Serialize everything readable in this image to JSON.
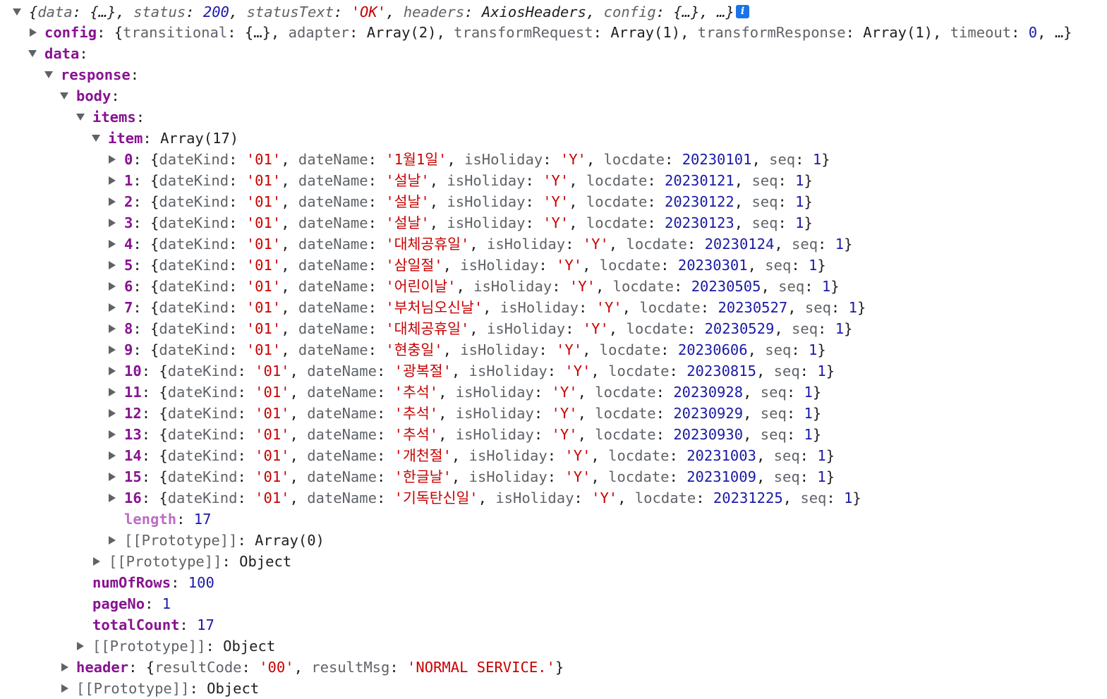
{
  "root": {
    "summary_open": "{",
    "k_data": "data",
    "v_data": "{…}",
    "k_status": "status",
    "v_status": "200",
    "k_statusText": "statusText",
    "v_statusText": "'OK'",
    "k_headers": "headers",
    "v_headers": "AxiosHeaders",
    "k_config": "config",
    "v_config": "{…}",
    "tail": ", …}",
    "info_glyph": "i"
  },
  "config_row": {
    "key": "config",
    "k_transitional": "transitional",
    "v_transitional": "{…}",
    "k_adapter": "adapter",
    "v_adapter": "Array(2)",
    "k_transformRequest": "transformRequest",
    "v_transformRequest": "Array(1)",
    "k_transformResponse": "transformResponse",
    "v_transformResponse": "Array(1)",
    "k_timeout": "timeout",
    "v_timeout": "0",
    "tail": ", …}"
  },
  "keys": {
    "data": "data",
    "response": "response",
    "body": "body",
    "items": "items",
    "item": "item",
    "item_value": "Array(17)",
    "length": "length",
    "length_value": "17",
    "proto": "[[Prototype]]",
    "proto_array": "Array(0)",
    "proto_object": "Object",
    "numOfRows": "numOfRows",
    "numOfRows_value": "100",
    "pageNo": "pageNo",
    "pageNo_value": "1",
    "totalCount": "totalCount",
    "totalCount_value": "17",
    "header": "header",
    "resultCode": "resultCode",
    "resultCode_value": "'00'",
    "resultMsg": "resultMsg",
    "resultMsg_value": "'NORMAL SERVICE.'"
  },
  "item_fields": {
    "dateKind": "dateKind",
    "dateName": "dateName",
    "isHoliday": "isHoliday",
    "locdate": "locdate",
    "seq": "seq"
  },
  "items": [
    {
      "index": "0",
      "dateKind": "'01'",
      "dateName": "'1월1일'",
      "isHoliday": "'Y'",
      "locdate": "20230101",
      "seq": "1"
    },
    {
      "index": "1",
      "dateKind": "'01'",
      "dateName": "'설날'",
      "isHoliday": "'Y'",
      "locdate": "20230121",
      "seq": "1"
    },
    {
      "index": "2",
      "dateKind": "'01'",
      "dateName": "'설날'",
      "isHoliday": "'Y'",
      "locdate": "20230122",
      "seq": "1"
    },
    {
      "index": "3",
      "dateKind": "'01'",
      "dateName": "'설날'",
      "isHoliday": "'Y'",
      "locdate": "20230123",
      "seq": "1"
    },
    {
      "index": "4",
      "dateKind": "'01'",
      "dateName": "'대체공휴일'",
      "isHoliday": "'Y'",
      "locdate": "20230124",
      "seq": "1"
    },
    {
      "index": "5",
      "dateKind": "'01'",
      "dateName": "'삼일절'",
      "isHoliday": "'Y'",
      "locdate": "20230301",
      "seq": "1"
    },
    {
      "index": "6",
      "dateKind": "'01'",
      "dateName": "'어린이날'",
      "isHoliday": "'Y'",
      "locdate": "20230505",
      "seq": "1"
    },
    {
      "index": "7",
      "dateKind": "'01'",
      "dateName": "'부처님오신날'",
      "isHoliday": "'Y'",
      "locdate": "20230527",
      "seq": "1"
    },
    {
      "index": "8",
      "dateKind": "'01'",
      "dateName": "'대체공휴일'",
      "isHoliday": "'Y'",
      "locdate": "20230529",
      "seq": "1"
    },
    {
      "index": "9",
      "dateKind": "'01'",
      "dateName": "'현충일'",
      "isHoliday": "'Y'",
      "locdate": "20230606",
      "seq": "1"
    },
    {
      "index": "10",
      "dateKind": "'01'",
      "dateName": "'광복절'",
      "isHoliday": "'Y'",
      "locdate": "20230815",
      "seq": "1"
    },
    {
      "index": "11",
      "dateKind": "'01'",
      "dateName": "'추석'",
      "isHoliday": "'Y'",
      "locdate": "20230928",
      "seq": "1"
    },
    {
      "index": "12",
      "dateKind": "'01'",
      "dateName": "'추석'",
      "isHoliday": "'Y'",
      "locdate": "20230929",
      "seq": "1"
    },
    {
      "index": "13",
      "dateKind": "'01'",
      "dateName": "'추석'",
      "isHoliday": "'Y'",
      "locdate": "20230930",
      "seq": "1"
    },
    {
      "index": "14",
      "dateKind": "'01'",
      "dateName": "'개천절'",
      "isHoliday": "'Y'",
      "locdate": "20231003",
      "seq": "1"
    },
    {
      "index": "15",
      "dateKind": "'01'",
      "dateName": "'한글날'",
      "isHoliday": "'Y'",
      "locdate": "20231009",
      "seq": "1"
    },
    {
      "index": "16",
      "dateKind": "'01'",
      "dateName": "'기독탄신일'",
      "isHoliday": "'Y'",
      "locdate": "20231225",
      "seq": "1"
    }
  ]
}
